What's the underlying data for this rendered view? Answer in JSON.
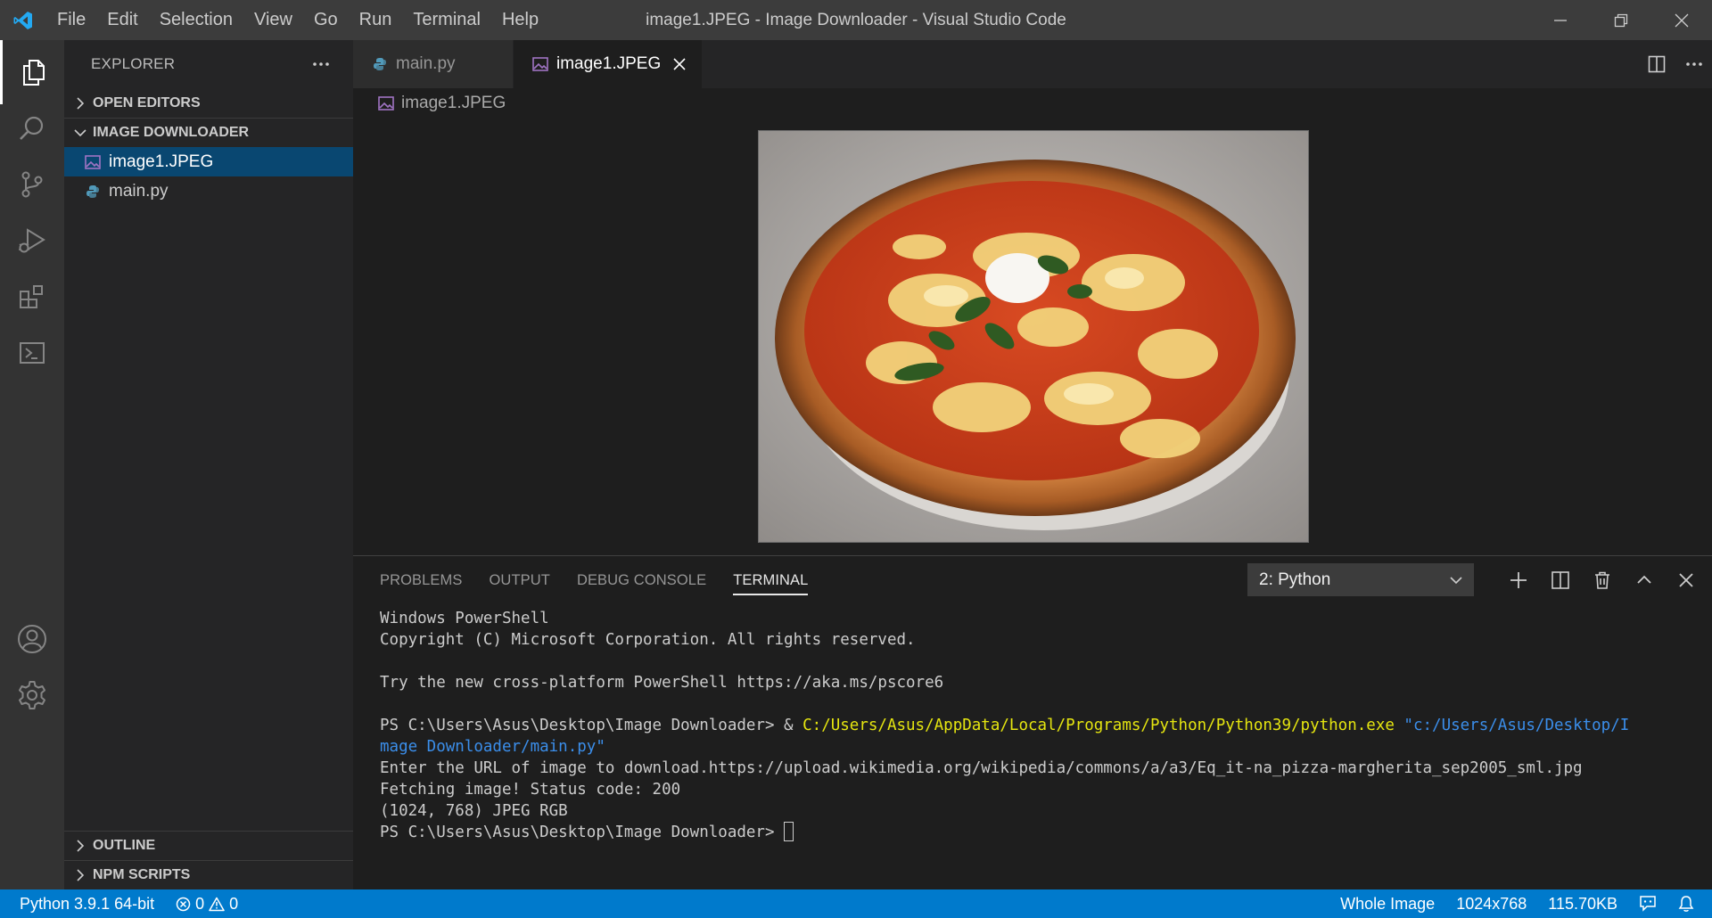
{
  "window": {
    "title": "image1.JPEG - Image Downloader - Visual Studio Code"
  },
  "menu": [
    "File",
    "Edit",
    "Selection",
    "View",
    "Go",
    "Run",
    "Terminal",
    "Help"
  ],
  "activity_bar": {
    "items": [
      "files-icon",
      "search-icon",
      "source-control-icon",
      "run-debug-icon",
      "extensions-icon",
      "remote-explorer-icon"
    ],
    "bottom": [
      "account-icon",
      "settings-gear-icon"
    ]
  },
  "sidebar": {
    "title": "EXPLORER",
    "open_editors": "OPEN EDITORS",
    "folder": "IMAGE DOWNLOADER",
    "files": [
      {
        "name": "image1.JPEG",
        "type": "image",
        "selected": true
      },
      {
        "name": "main.py",
        "type": "python",
        "selected": false
      }
    ],
    "outline": "OUTLINE",
    "npm_scripts": "NPM SCRIPTS"
  },
  "editor": {
    "tabs": [
      {
        "label": "main.py",
        "active": false
      },
      {
        "label": "image1.JPEG",
        "active": true
      }
    ],
    "breadcrumb": "image1.JPEG",
    "image_alt": "Pizza Margherita"
  },
  "panel": {
    "tabs": [
      "PROBLEMS",
      "OUTPUT",
      "DEBUG CONSOLE",
      "TERMINAL"
    ],
    "active_tab": "TERMINAL",
    "terminal_select": "2: Python",
    "terminal": {
      "l1": "Windows PowerShell",
      "l2": "Copyright (C) Microsoft Corporation. All rights reserved.",
      "l3": "Try the new cross-platform PowerShell https://aka.ms/pscore6",
      "l4_prompt": "PS C:\\Users\\Asus\\Desktop\\Image Downloader> & ",
      "l4_exe": "C:/Users/Asus/AppData/Local/Programs/Python/Python39/python.exe",
      "l4_arg1": " \"c:/Users/Asus/Desktop/I",
      "l5_arg2": "mage Downloader/main.py\"",
      "l6": "Enter the URL of image to download.https://upload.wikimedia.org/wikipedia/commons/a/a3/Eq_it-na_pizza-margherita_sep2005_sml.jpg",
      "l7": "Fetching image! Status code: 200",
      "l8": "(1024, 768) JPEG RGB",
      "l9": "PS C:\\Users\\Asus\\Desktop\\Image Downloader> "
    }
  },
  "status_bar": {
    "python": "Python 3.9.1 64-bit",
    "errors": "0",
    "warnings": "0",
    "zoom": "Whole Image",
    "dimensions": "1024x768",
    "size": "115.70KB"
  },
  "colors": {
    "accent": "#007acc",
    "selection": "#094771",
    "terminal_yellow": "#e5e510",
    "terminal_blue": "#3b8eea"
  }
}
